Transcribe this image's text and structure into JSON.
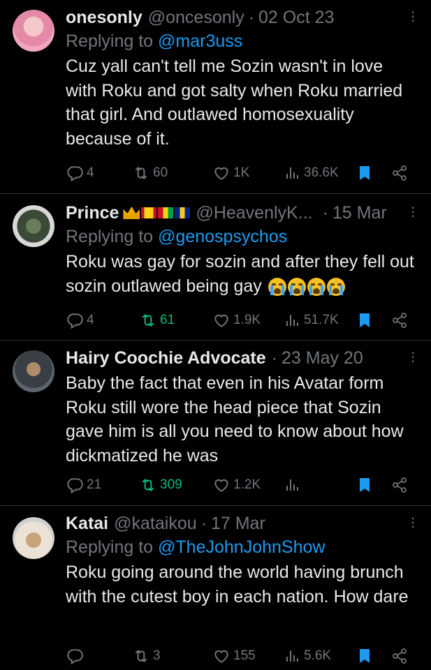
{
  "tweets": [
    {
      "name": "onesonly",
      "handle": "@oncesonly",
      "sep": "·",
      "date": "02 Oct 23",
      "replying_label": "Replying to",
      "replying_to": "@mar3uss",
      "text": "Cuz yall can't tell me Sozin wasn't in love with Roku and got salty when Roku married that girl. And outlawed homosexuality because of it.",
      "replies": "4",
      "retweets": "60",
      "likes": "1K",
      "views": "36.6K"
    },
    {
      "name": "Prince",
      "handle": "@HeavenlyK...",
      "sep": "·",
      "date": "15 Mar",
      "replying_label": "Replying to",
      "replying_to": "@genospsychos",
      "text": "Roku was gay for sozin and after they fell out sozin outlawed being gay",
      "replies": "4",
      "retweets": "61",
      "likes": "1.9K",
      "views": "51.7K"
    },
    {
      "name": "Hairy Coochie Advocate",
      "handle": "",
      "sep": "·",
      "date": "23 May 20",
      "text": "Baby the fact that even in his Avatar form Roku still wore the head piece that Sozin gave him is all you need to know about how dickmatized he was",
      "replies": "21",
      "retweets": "309",
      "likes": "1.2K",
      "views": ""
    },
    {
      "name": "Katai",
      "handle": "@kataikou",
      "sep": "·",
      "date": "17 Mar",
      "replying_label": "Replying to",
      "replying_to": "@TheJohnJohnShow",
      "text": "Roku going around the world having brunch with the cutest boy in each nation. How dare",
      "replies": "",
      "retweets": "3",
      "likes": "155",
      "views": "5.6K"
    }
  ],
  "colors": {
    "muted": "#71767b",
    "link": "#1d9bf0",
    "green": "#00ba7c",
    "bookmark": "#1d9bf0"
  }
}
